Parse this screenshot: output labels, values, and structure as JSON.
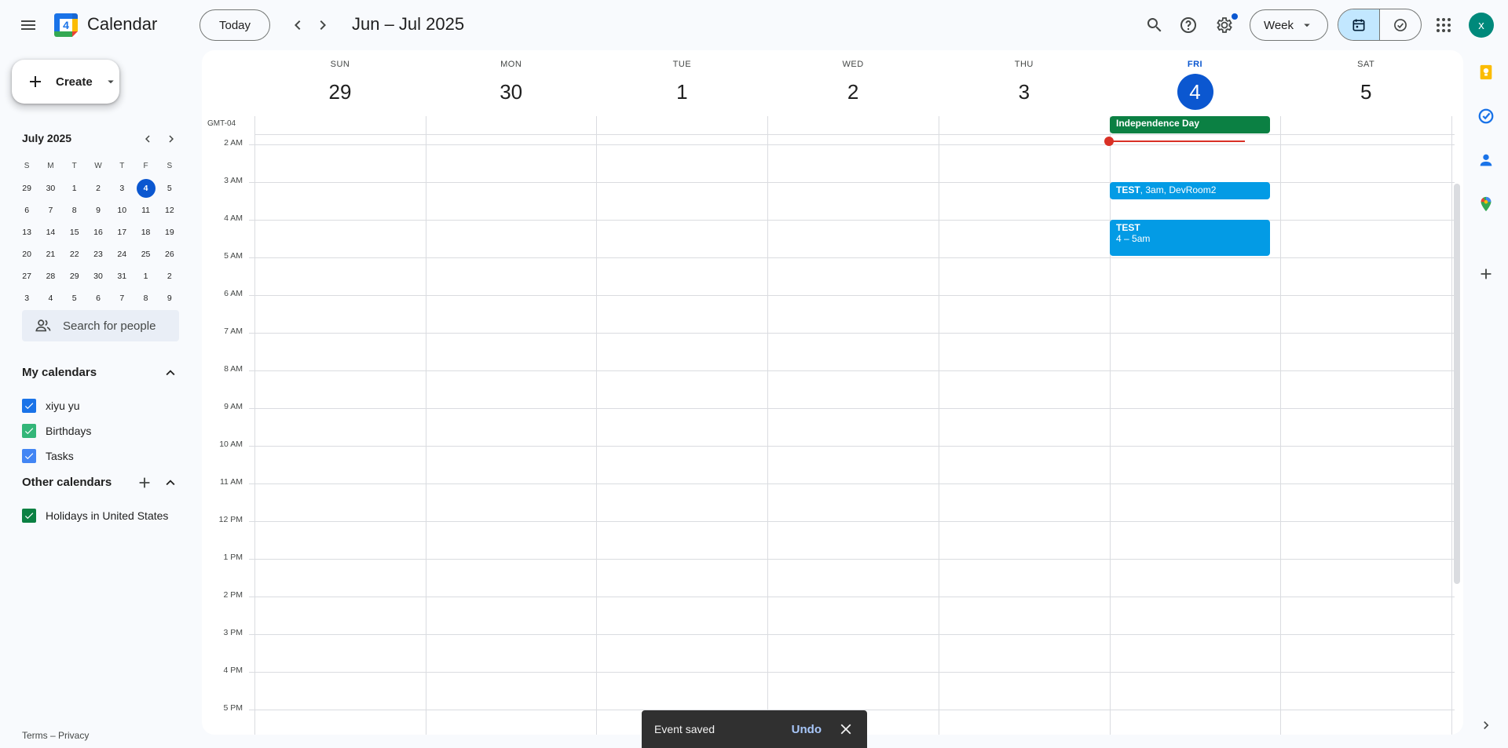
{
  "header": {
    "app_title": "Calendar",
    "logo_day": "4",
    "today_label": "Today",
    "date_range": "Jun – Jul 2025",
    "view_label": "Week",
    "avatar_initial": "x"
  },
  "sidebar": {
    "create_label": "Create",
    "mini_calendar": {
      "title": "July 2025",
      "weekday_heads": [
        "S",
        "M",
        "T",
        "W",
        "T",
        "F",
        "S"
      ],
      "weeks": [
        [
          "29",
          "30",
          "1",
          "2",
          "3",
          "4",
          "5"
        ],
        [
          "6",
          "7",
          "8",
          "9",
          "10",
          "11",
          "12"
        ],
        [
          "13",
          "14",
          "15",
          "16",
          "17",
          "18",
          "19"
        ],
        [
          "20",
          "21",
          "22",
          "23",
          "24",
          "25",
          "26"
        ],
        [
          "27",
          "28",
          "29",
          "30",
          "31",
          "1",
          "2"
        ],
        [
          "3",
          "4",
          "5",
          "6",
          "7",
          "8",
          "9"
        ]
      ],
      "today": "4"
    },
    "people_search_placeholder": "Search for people",
    "my_calendars_title": "My calendars",
    "my_calendars": [
      {
        "name": "xiyu yu",
        "color": "#1a73e8"
      },
      {
        "name": "Birthdays",
        "color": "#33b679"
      },
      {
        "name": "Tasks",
        "color": "#4285f4"
      }
    ],
    "other_calendars_title": "Other calendars",
    "other_calendars": [
      {
        "name": "Holidays in United States",
        "color": "#0b8043"
      }
    ],
    "footer_terms": "Terms",
    "footer_sep": " – ",
    "footer_privacy": "Privacy"
  },
  "week": {
    "timezone": "GMT-04",
    "days": [
      {
        "dow": "SUN",
        "num": "29"
      },
      {
        "dow": "MON",
        "num": "30"
      },
      {
        "dow": "TUE",
        "num": "1"
      },
      {
        "dow": "WED",
        "num": "2"
      },
      {
        "dow": "THU",
        "num": "3"
      },
      {
        "dow": "FRI",
        "num": "4",
        "today": true
      },
      {
        "dow": "SAT",
        "num": "5"
      }
    ],
    "hours": [
      "2 AM",
      "3 AM",
      "4 AM",
      "5 AM",
      "6 AM",
      "7 AM",
      "8 AM",
      "9 AM",
      "10 AM",
      "11 AM",
      "12 PM",
      "1 PM",
      "2 PM",
      "3 PM",
      "4 PM",
      "5 PM"
    ],
    "allday_event": {
      "title": "Independence Day",
      "color": "#0b8043"
    },
    "events": [
      {
        "title": "TEST",
        "detail": ", 3am, DevRoom2",
        "color": "#039be5"
      },
      {
        "title": "TEST",
        "time": "4 – 5am",
        "color": "#039be5"
      }
    ]
  },
  "snackbar": {
    "message": "Event saved",
    "action": "Undo"
  },
  "colors": {
    "accent": "#0b57d0",
    "now_line": "#d93025"
  }
}
